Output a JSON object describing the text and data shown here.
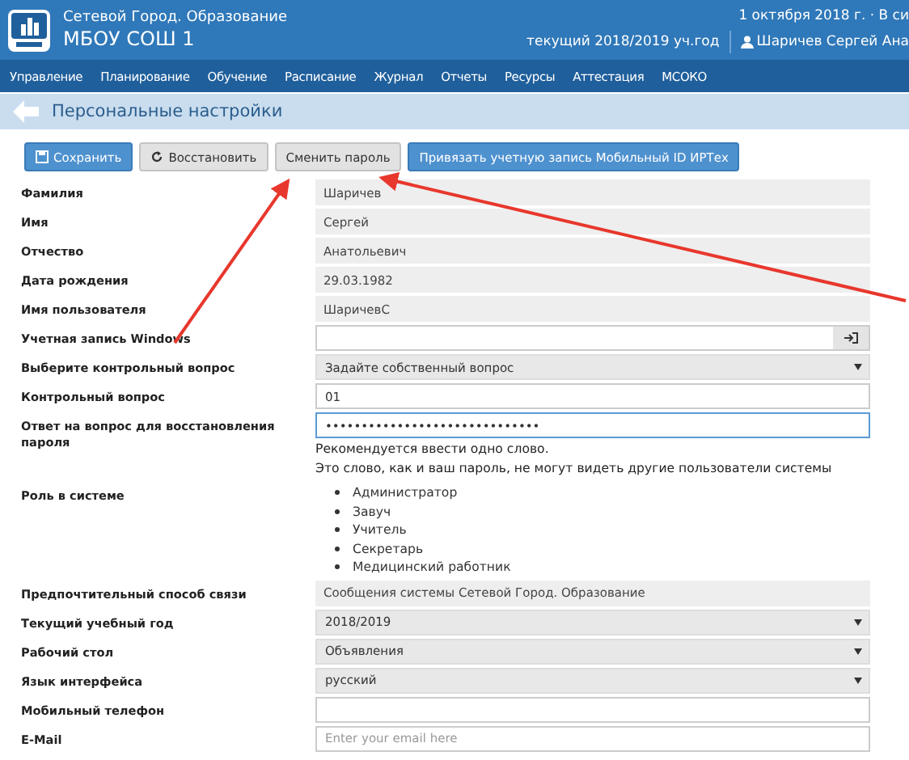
{
  "header": {
    "app_name": "Сетевой Город. Образование",
    "school": "МБОУ СОШ 1",
    "date": "1 октября 2018 г. · В си",
    "year": "текущий 2018/2019 уч.год",
    "user": "Шаричев Сергей Ана"
  },
  "nav": [
    "Управление",
    "Планирование",
    "Обучение",
    "Расписание",
    "Журнал",
    "Отчеты",
    "Ресурсы",
    "Аттестация",
    "МСОКО"
  ],
  "page_title": "Персональные настройки",
  "toolbar": [
    {
      "label": "Сохранить",
      "kind": "primary"
    },
    {
      "label": "Восстановить",
      "kind": "default"
    },
    {
      "label": "Сменить пароль",
      "kind": "default"
    },
    {
      "label": "Привязать учетную запись Мобильный ID ИРТех",
      "kind": "primary"
    }
  ],
  "fields": [
    {
      "label": "Фамилия",
      "kind": "readonly",
      "value": "Шаричев"
    },
    {
      "label": "Имя",
      "kind": "readonly",
      "value": "Сергей"
    },
    {
      "label": "Отчество",
      "kind": "readonly",
      "value": "Анатольевич"
    },
    {
      "label": "Дата рождения",
      "kind": "readonly",
      "value": "29.03.1982"
    },
    {
      "label": "Имя пользователя",
      "kind": "readonly",
      "value": "ШаричевС"
    },
    {
      "label": "Учетная запись Windows",
      "kind": "input_button"
    },
    {
      "label": "Выберите контрольный вопрос",
      "kind": "select",
      "value": "Задайте собственный вопрос"
    },
    {
      "label": "Контрольный вопрос",
      "kind": "input",
      "value": "01"
    },
    {
      "label": "Ответ на вопрос для восстановления пароля",
      "kind": "password",
      "value": "••••••••••••••••••••••••••••••",
      "focused": true,
      "hints": [
        "Рекомендуется ввести одно слово.",
        "Это слово, как и ваш пароль, не могут видеть другие пользователи системы"
      ]
    },
    {
      "label": "Роль в системе",
      "kind": "list",
      "items": [
        "Администратор",
        "Завуч",
        "Учитель",
        "Секретарь",
        "Медицинский работник"
      ]
    },
    {
      "label": "Предпочтительный способ связи",
      "kind": "readonly",
      "value": "Сообщения системы Сетевой Город. Образование"
    },
    {
      "label": "Текущий учебный год",
      "kind": "select",
      "value": "2018/2019"
    },
    {
      "label": "Рабочий стол",
      "kind": "select",
      "value": "Объявления"
    },
    {
      "label": "Язык интерфейса",
      "kind": "select",
      "value": "русский"
    },
    {
      "label": "Мобильный телефон",
      "kind": "input"
    },
    {
      "label": "E-Mail",
      "kind": "input",
      "placeholder": "Enter your email here"
    }
  ]
}
